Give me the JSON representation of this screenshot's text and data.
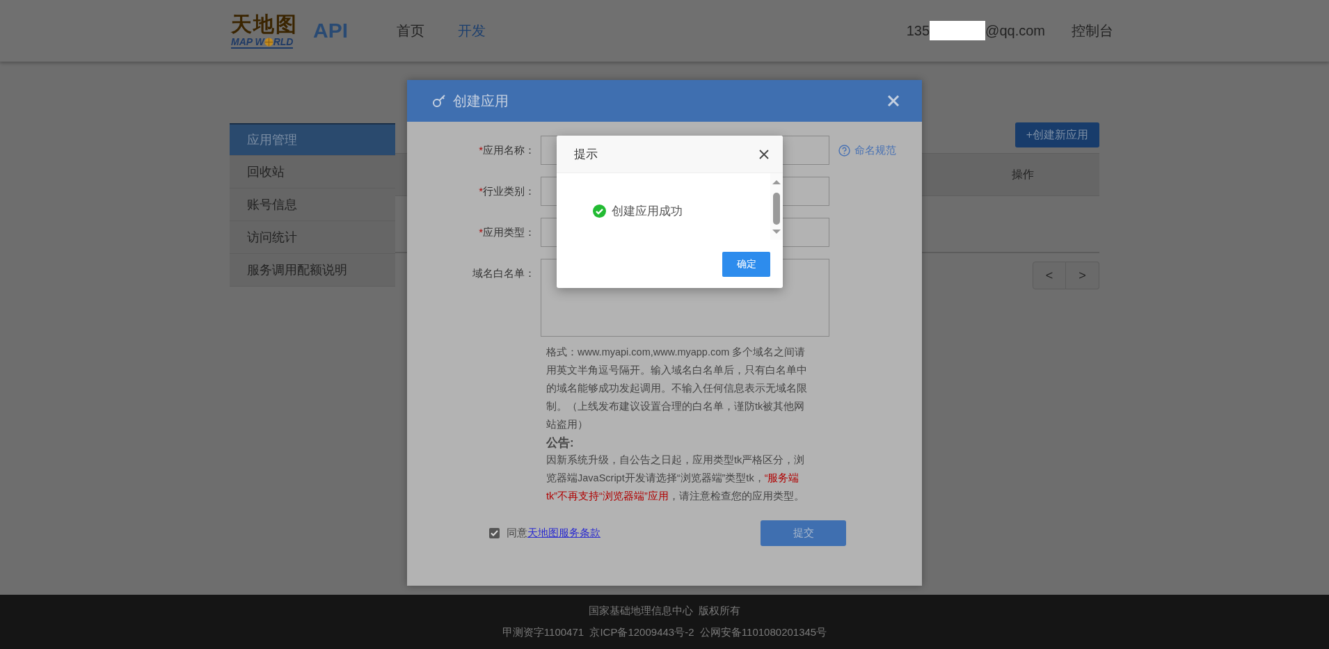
{
  "header": {
    "logo_top": "天地图",
    "logo_bottom_left": "MAP W",
    "logo_bottom_right": "RLD",
    "product": "API",
    "nav": [
      {
        "label": "首页",
        "selected": false
      },
      {
        "label": "开发",
        "selected": true
      }
    ],
    "account_prefix": "135",
    "account_suffix": "@qq.com",
    "console": "控制台"
  },
  "sidebar": {
    "items": [
      {
        "label": "应用管理",
        "selected": true
      },
      {
        "label": "回收站",
        "selected": false
      },
      {
        "label": "账号信息",
        "selected": false
      },
      {
        "label": "访问统计",
        "selected": false
      },
      {
        "label": "服务调用配额说明",
        "selected": false
      }
    ]
  },
  "main": {
    "create_button": "+创建新应用",
    "table": {
      "columns": [
        "操作"
      ]
    },
    "pager": [
      "<",
      ">"
    ]
  },
  "dialog": {
    "title": "创建应用",
    "fields": [
      {
        "mark": "*",
        "label": "应用名称：",
        "kind": "input"
      },
      {
        "mark": "*",
        "label": "行业类别：",
        "kind": "input"
      },
      {
        "mark": "*",
        "label": "应用类型：",
        "kind": "input"
      },
      {
        "label": "域名白名单：",
        "kind": "textarea"
      }
    ],
    "naming_link": "命名规范",
    "hint": "格式：www.myapi.com,www.myapp.com 多个域名之间请用英文半角逗号隔开。输入域名白名单后，只有白名单中的域名能够成功发起调用。不输入任何信息表示无域名限制。（上线发布建议设置合理的白名单，谨防tk被其他网站盗用）",
    "notice_title": "公告:",
    "notice": [
      {
        "text": "因新系统升级，自公告之日起，应用类型tk严格区分，浏览器端JavaScript开发请选择“浏览器端”类型tk，",
        "warning": false
      },
      {
        "text": "“服务端tk”不再支持“浏览器端”应用",
        "warning": true
      },
      {
        "text": "，请注意检查您的应用类型。",
        "warning": false
      }
    ],
    "agree": {
      "checked": true,
      "text": "同意",
      "link": "天地图服务条款"
    },
    "submit": "提交"
  },
  "alert": {
    "title": "提示",
    "message": "创建应用成功",
    "ok": "确定"
  },
  "footer": {
    "lines": [
      "国家基础地理信息中心  版权所有",
      "甲测资字1100471  京ICP备12009443号-2  公网安备1101080201345号"
    ]
  }
}
